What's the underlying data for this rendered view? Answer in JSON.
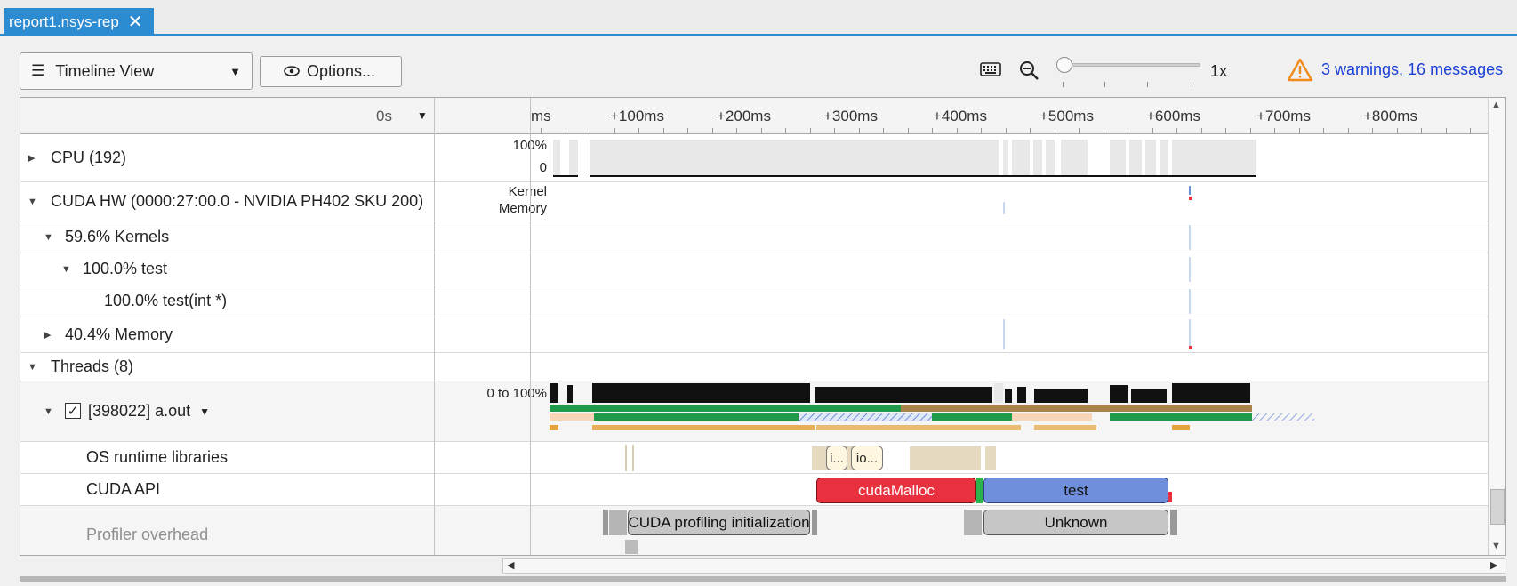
{
  "tab": {
    "title": "report1.nsys-rep",
    "close_glyph": "✕"
  },
  "toolbar": {
    "view_select": {
      "label": "Timeline View",
      "icon": "menu-lines-icon"
    },
    "options_button": {
      "label": "Options...",
      "icon": "eye-icon"
    },
    "zoom": {
      "level": "1x",
      "slider_fraction": 0.0
    },
    "warnings_link": "3 warnings, 16 messages"
  },
  "timeline": {
    "origin_label": "0s",
    "ruler_labels": [
      "ms",
      "+100ms",
      "+200ms",
      "+300ms",
      "+400ms",
      "+500ms",
      "+600ms",
      "+700ms",
      "+800ms"
    ],
    "rows": {
      "cpu": {
        "label": "CPU (192)",
        "axis_top": "100%",
        "axis_bottom": "0"
      },
      "cuda_hw": {
        "label": "CUDA HW (0000:27:00.0 - NVIDIA PH402 SKU 200)",
        "axis_top": "Kernel",
        "axis_bottom": "Memory"
      },
      "kernels": {
        "label": "59.6% Kernels"
      },
      "test": {
        "label": "100.0% test"
      },
      "test_int": {
        "label": "100.0% test(int *)"
      },
      "memory": {
        "label": "40.4% Memory"
      },
      "threads": {
        "label": "Threads (8)"
      },
      "thread_main": {
        "label": "[398022] a.out",
        "axis": "0 to 100%",
        "checked": "✓"
      },
      "os_runtime": {
        "label": "OS runtime libraries",
        "blocks": [
          "i...",
          "io..."
        ]
      },
      "cuda_api": {
        "label": "CUDA API",
        "blocks": [
          "cudaMalloc",
          "test"
        ]
      },
      "profiler": {
        "label": "Profiler overhead",
        "blocks": [
          "CUDA profiling initialization",
          "Unknown"
        ]
      }
    }
  },
  "colors": {
    "accent": "#2d8bd2",
    "cuda_malloc": "#e8303f",
    "cuda_test": "#6f8edb",
    "warning": "#f28a1b",
    "link": "#1a3fd4"
  }
}
